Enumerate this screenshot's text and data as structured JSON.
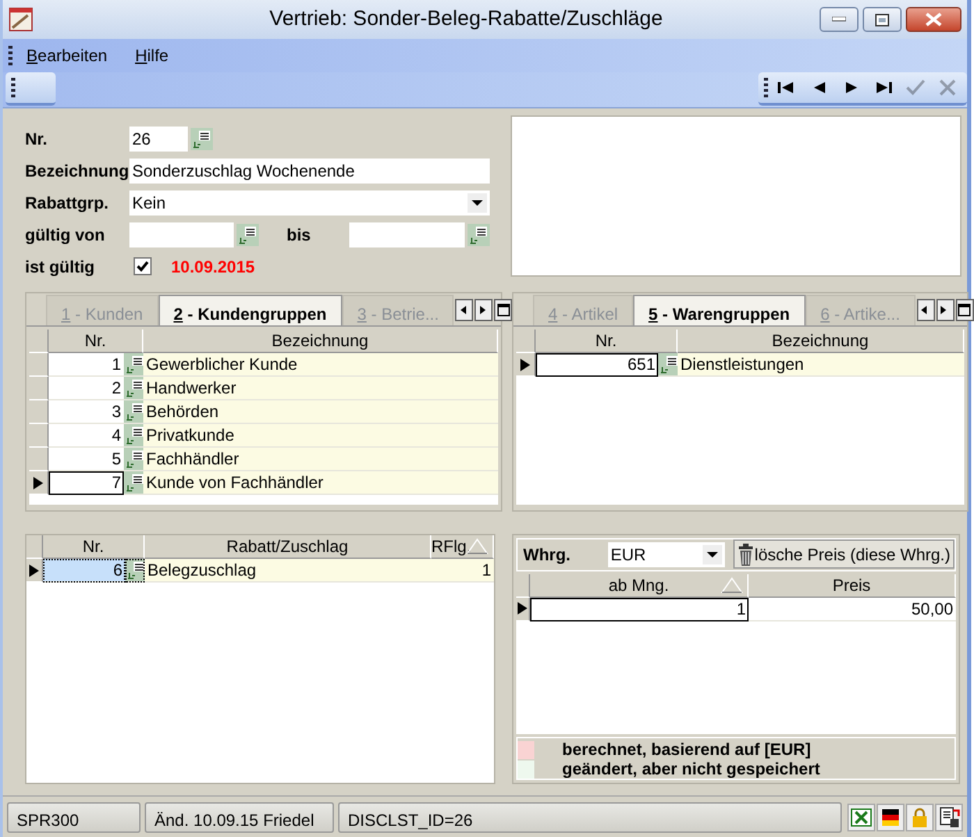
{
  "window": {
    "title": "Vertrieb: Sonder-Beleg-Rabatte/Zuschläge"
  },
  "menu": [
    {
      "label": "Bearbeiten"
    },
    {
      "label": "Hilfe"
    }
  ],
  "nav_buttons": [
    {
      "kind": "first",
      "disabled": false
    },
    {
      "kind": "prev",
      "disabled": false
    },
    {
      "kind": "next",
      "disabled": false
    },
    {
      "kind": "last",
      "disabled": false
    },
    {
      "kind": "confirm",
      "disabled": true
    },
    {
      "kind": "cancel",
      "disabled": true
    }
  ],
  "form": {
    "nr": {
      "label": "Nr.",
      "value": "26"
    },
    "bezeichnung": {
      "label": "Bezeichnung",
      "value": "Sonderzuschlag Wochenende"
    },
    "rabattgrp": {
      "label": "Rabattgrp.",
      "value": "Kein"
    },
    "gueltig_von": {
      "label": "gültig von"
    },
    "bis": {
      "label": "bis"
    },
    "ist_gueltig": {
      "label": "ist gültig",
      "checked": true,
      "date": "10.09.2015"
    }
  },
  "customer_panel": {
    "tabs": [
      {
        "label": "1 - Kunden",
        "selected": false
      },
      {
        "label": "2 - Kundengruppen",
        "selected": true
      },
      {
        "label": "3 - Betrie...",
        "selected": false
      }
    ],
    "columns": [
      "Nr.",
      "Bezeichnung"
    ],
    "rows": [
      {
        "nr": "1",
        "name": "Gewerblicher Kunde",
        "selected": false
      },
      {
        "nr": "2",
        "name": "Handwerker",
        "selected": false
      },
      {
        "nr": "3",
        "name": "Behörden",
        "selected": false
      },
      {
        "nr": "4",
        "name": "Privatkunde",
        "selected": false
      },
      {
        "nr": "5",
        "name": "Fachhändler",
        "selected": false
      },
      {
        "nr": "7",
        "name": "Kunde von Fachhändler",
        "selected": true
      }
    ]
  },
  "article_panel": {
    "tabs": [
      {
        "label": "4 - Artikel",
        "selected": false
      },
      {
        "label": "5 - Warengruppen",
        "selected": true
      },
      {
        "label": "6 - Artike...",
        "selected": false
      }
    ],
    "columns": [
      "Nr.",
      "Bezeichnung"
    ],
    "rows": [
      {
        "nr": "651",
        "name": "Dienstleistungen",
        "selected": true
      }
    ]
  },
  "discount_table": {
    "columns": [
      {
        "label": "Nr.",
        "sorted": false
      },
      {
        "label": "Rabatt/Zuschlag",
        "sorted": false
      },
      {
        "label": "RFlg.",
        "sorted": true
      }
    ],
    "rows": [
      {
        "nr": "6",
        "name": "Belegzuschlag",
        "rflg": "1",
        "selected": true
      }
    ]
  },
  "price_panel": {
    "currency_label": "Whrg.",
    "currency": "EUR",
    "delete_button": "lösche Preis (diese Whrg.)",
    "columns": [
      {
        "label": "ab Mng.",
        "sorted": true
      },
      {
        "label": "Preis",
        "sorted": false
      }
    ],
    "rows": [
      {
        "qty": "1",
        "price": "50,00",
        "selected": true
      }
    ],
    "legend": [
      {
        "color": "#f9d3d3",
        "text": "berechnet, basierend auf [EUR]"
      },
      {
        "color": "#eef8ee",
        "text": "geändert, aber nicht gespeichert"
      }
    ]
  },
  "status_bar": [
    "SPR300",
    "Änd. 10.09.15 Friedel",
    "DISCLST_ID=26"
  ]
}
